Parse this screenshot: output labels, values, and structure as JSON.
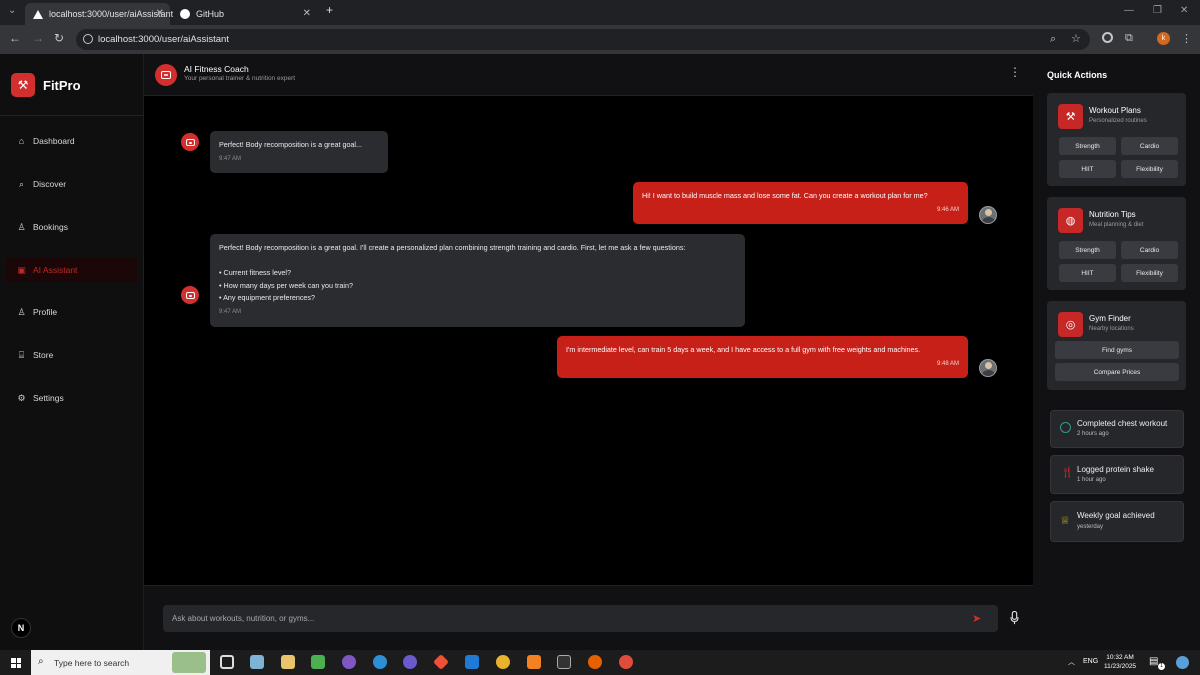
{
  "browser": {
    "tabs": [
      {
        "title": "localhost:3000/user/aiAssistant",
        "active": true
      },
      {
        "title": "GitHub",
        "active": false
      }
    ],
    "url": "localhost:3000/user/aiAssistant",
    "profile_initial": "k"
  },
  "sidebar": {
    "brand": "FitPro",
    "items": [
      {
        "label": "Dashboard",
        "icon": "home-icon"
      },
      {
        "label": "Discover",
        "icon": "search-icon"
      },
      {
        "label": "Bookings",
        "icon": "user-icon"
      },
      {
        "label": "AI Assistant",
        "icon": "bot-icon",
        "active": true
      },
      {
        "label": "Profile",
        "icon": "user-icon"
      },
      {
        "label": "Store",
        "icon": "store-icon"
      },
      {
        "label": "Settings",
        "icon": "gear-icon"
      }
    ],
    "badge": "N"
  },
  "chat": {
    "title": "AI Fitness Coach",
    "subtitle": "Your personal trainer & nutrition expert",
    "messages": [
      {
        "role": "bot",
        "lines": [
          "Perfect! Body recomposition is a great goal..."
        ],
        "time": "9:47 AM"
      },
      {
        "role": "user",
        "lines": [
          "Hi! I want to build muscle mass and lose some fat. Can you create a workout plan for me?"
        ],
        "time": "9:46 AM"
      },
      {
        "role": "bot",
        "lines": [
          "Perfect! Body recomposition is a great goal. I'll create a personalized plan combining strength training and cardio. First, let me ask a few questions:",
          "",
          "• Current fitness level?",
          "• How many days per week can you train?",
          "• Any equipment preferences?"
        ],
        "time": "9:47 AM"
      },
      {
        "role": "user",
        "lines": [
          "I'm intermediate level, can train 5 days a week, and I have access to a full gym with free weights and machines."
        ],
        "time": "9:48 AM"
      }
    ],
    "input_placeholder": "Ask about workouts, nutrition, or gyms..."
  },
  "quick_actions": {
    "title": "Quick Actions",
    "cards": [
      {
        "title": "Workout Plans",
        "subtitle": "Personalized routines",
        "icon": "dumbbell-icon",
        "buttons": [
          "Strength",
          "Cardio",
          "HIIT",
          "Flexibility"
        ]
      },
      {
        "title": "Nutrition Tips",
        "subtitle": "Meal planning & diet",
        "icon": "apple-icon",
        "buttons": [
          "Strength",
          "Cardio",
          "HIIT",
          "Flexibility"
        ]
      },
      {
        "title": "Gym Finder",
        "subtitle": "Nearby locations",
        "icon": "location-icon",
        "buttons": [
          "Find gyms",
          "Compare Prices"
        ]
      }
    ],
    "activity": [
      {
        "title": "Completed chest workout",
        "time": "2 hours ago",
        "icon": "check-circle-icon",
        "color": "#2a9d8f"
      },
      {
        "title": "Logged protein shake",
        "time": "1 hour ago",
        "icon": "utensils-icon",
        "color": "#c62828"
      },
      {
        "title": "Weekly goal achieved",
        "time": "yesterday",
        "icon": "trophy-icon",
        "color": "#b5a81f"
      }
    ]
  },
  "taskbar": {
    "search_placeholder": "Type here to search",
    "lang": "ENG",
    "time": "10:32 AM",
    "date": "11/23/2025",
    "notifications": "1"
  }
}
